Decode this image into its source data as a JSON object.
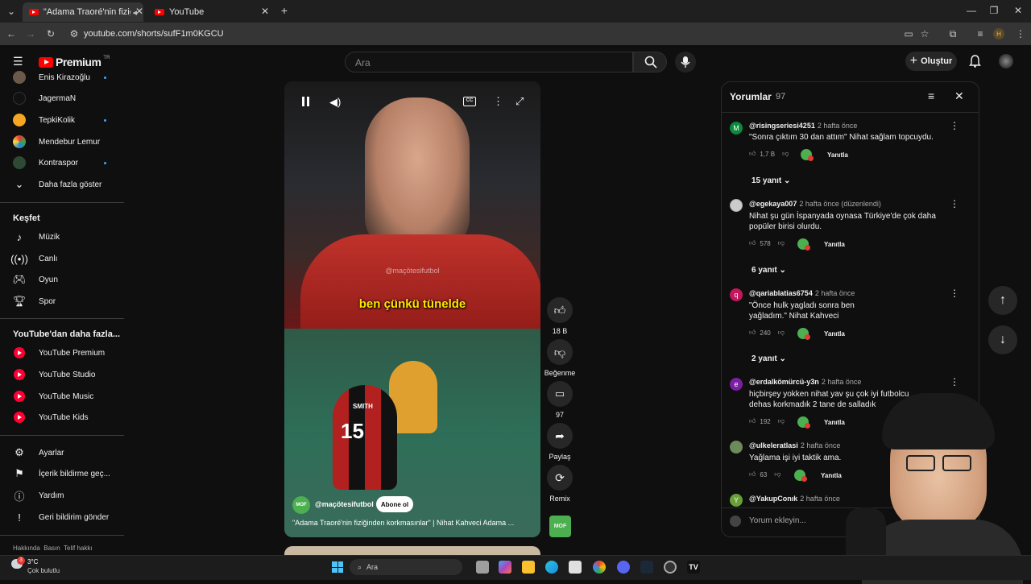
{
  "browser": {
    "tabs": [
      {
        "title": "\"Adama Traoré'nin fiziğinde",
        "active": true
      },
      {
        "title": "YouTube",
        "active": false
      }
    ],
    "url": "youtube.com/shorts/sufF1m0KGCU",
    "profile_initial": "H"
  },
  "header": {
    "logo_text": "Premium",
    "region": "TR",
    "search_placeholder": "Ara",
    "create_label": "Oluştur"
  },
  "sidebar": {
    "subscriptions": [
      {
        "label": "Enis Kirazoğlu",
        "dot": true
      },
      {
        "label": "JagermaN",
        "dot": false
      },
      {
        "label": "TepkiKolik",
        "dot": true
      },
      {
        "label": "Mendebur Lemur",
        "dot": false
      },
      {
        "label": "Kontraspor",
        "dot": true
      }
    ],
    "show_more": "Daha fazla göster",
    "explore_title": "Keşfet",
    "explore": [
      "Müzik",
      "Canlı",
      "Oyun",
      "Spor"
    ],
    "more_title": "YouTube'dan daha fazla...",
    "more": [
      "YouTube Premium",
      "YouTube Studio",
      "YouTube Music",
      "YouTube Kids"
    ],
    "settings": [
      "Ayarlar",
      "İçerik bildirme geç...",
      "Yardım",
      "Geri bildirim gönder"
    ],
    "footer": "Hakkında  Basın  Telif hakkı"
  },
  "video": {
    "watermark": "@maçötesifutbol",
    "caption": "ben çünkü tünelde",
    "channel": "@maçötesifutbol",
    "subscribe": "Abone ol",
    "title": "\"Adama Traoré'nin fiziğinden korkmasınlar\" | Nihat Kahveci Adama ...",
    "channel_badge": "MOF",
    "jersey_number": "15",
    "jersey_name": "SMITH"
  },
  "actions": {
    "like_count": "18 B",
    "dislike_label": "Beğenme",
    "comment_count": "97",
    "share_label": "Paylaş",
    "remix_label": "Remix"
  },
  "comments": {
    "title": "Yorumlar",
    "count": "97",
    "items": [
      {
        "avatar": "M",
        "avatar_color": "#0a8a3a",
        "user": "@risingseriesi4251",
        "time": "2 hafta önce",
        "text": "\"Sonra çıktım 30 dan attım\" Nihat sağlam topcuydu.",
        "likes": "1,7 B",
        "reply": "Yanıtla",
        "replies": "15 yanıt"
      },
      {
        "avatar": "",
        "avatar_color": "#cccccc",
        "user": "@egekaya007",
        "time": "2 hafta önce (düzenlendi)",
        "text": "Nihat şu gün İspanyada oynasa Türkiye'de çok daha popüler birisi olurdu.",
        "likes": "578",
        "reply": "Yanıtla",
        "replies": "6 yanıt"
      },
      {
        "avatar": "q",
        "avatar_color": "#c2185b",
        "user": "@qariablatias6754",
        "time": "2 hafta önce",
        "text": "\"Önce hulk yagladı sonra ben yağladım.\" Nihat Kahveci",
        "likes": "240",
        "reply": "Yanıtla",
        "replies": "2 yanıt"
      },
      {
        "avatar": "e",
        "avatar_color": "#7b1fa2",
        "user": "@erdalkömürcü-y3n",
        "time": "2 hafta önce",
        "text": "hiçbirşey yokken nihat yav şu çok iyi futbolcu dehas korkmadık 2 tane de salladık",
        "likes": "192",
        "reply": "Yanıtla",
        "replies": ""
      },
      {
        "avatar": "",
        "avatar_color": "#6d8a5a",
        "user": "@ulkeleratlasi",
        "time": "2 hafta önce",
        "text": "Yağlama işi iyi taktik ama.",
        "likes": "63",
        "reply": "Yanıtla",
        "replies": ""
      },
      {
        "avatar": "Y",
        "avatar_color": "#689f38",
        "user": "@YakupConık",
        "time": "2 hafta önce",
        "text": "",
        "likes": "",
        "reply": "",
        "replies": ""
      }
    ],
    "add_placeholder": "Yorum ekleyin..."
  },
  "taskbar": {
    "weather_temp": "3°C",
    "weather_desc": "Çok bulutlu",
    "weather_badge": "3",
    "search_label": "Ara"
  }
}
